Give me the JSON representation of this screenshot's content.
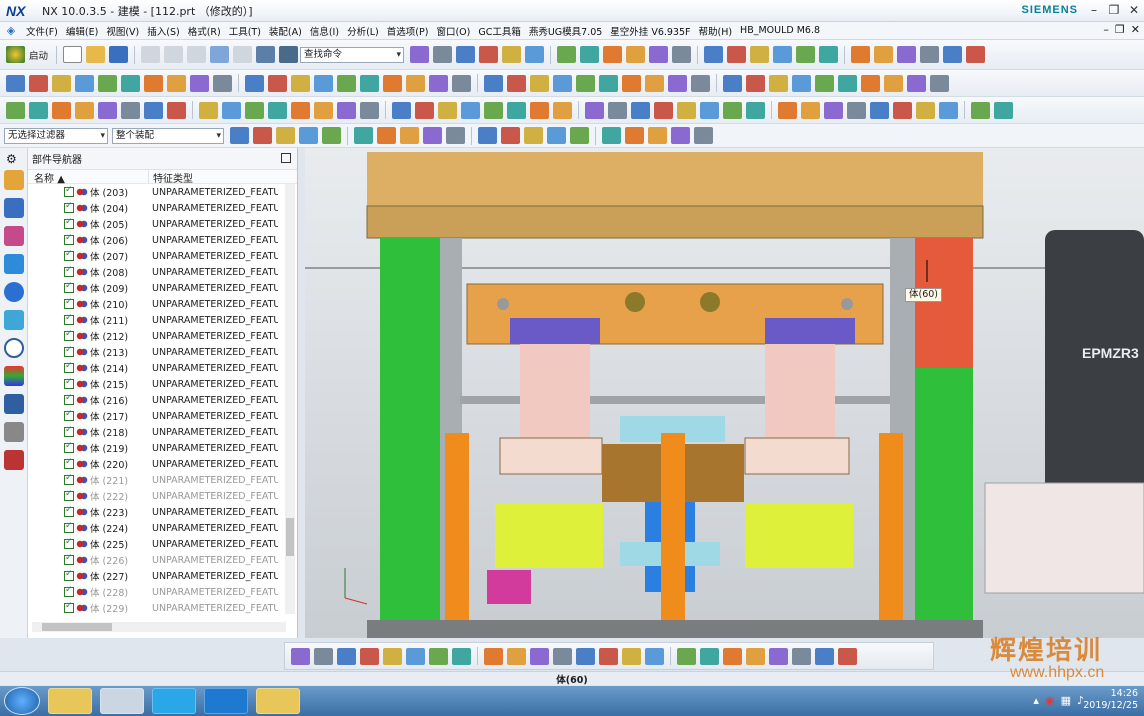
{
  "window": {
    "logo": "NX",
    "title": "NX 10.0.3.5 - 建模 - [112.prt （修改的）]",
    "brand": "SIEMENS"
  },
  "menu": [
    "文件(F)",
    "编辑(E)",
    "视图(V)",
    "插入(S)",
    "格式(R)",
    "工具(T)",
    "装配(A)",
    "信息(I)",
    "分析(L)",
    "首选项(P)",
    "窗口(O)",
    "GC工具箱",
    "燕秀UG模具7.05",
    "星空外挂 V6.935F",
    "帮助(H)",
    "HB_MOULD M6.8"
  ],
  "toolbar": {
    "start_label": "启动",
    "search_placeholder": "查找命令",
    "selection_filter": "无选择过滤器",
    "assembly_scope": "整个装配"
  },
  "navigator": {
    "title": "部件导航器",
    "col_name": "名称",
    "col_type": "特征类型",
    "rows": [
      {
        "name": "体 (203)",
        "type": "UNPARAMETERIZED_FEATU",
        "dim": false
      },
      {
        "name": "体 (204)",
        "type": "UNPARAMETERIZED_FEATU",
        "dim": false
      },
      {
        "name": "体 (205)",
        "type": "UNPARAMETERIZED_FEATU",
        "dim": false
      },
      {
        "name": "体 (206)",
        "type": "UNPARAMETERIZED_FEATU",
        "dim": false
      },
      {
        "name": "体 (207)",
        "type": "UNPARAMETERIZED_FEATU",
        "dim": false
      },
      {
        "name": "体 (208)",
        "type": "UNPARAMETERIZED_FEATU",
        "dim": false
      },
      {
        "name": "体 (209)",
        "type": "UNPARAMETERIZED_FEATU",
        "dim": false
      },
      {
        "name": "体 (210)",
        "type": "UNPARAMETERIZED_FEATU",
        "dim": false
      },
      {
        "name": "体 (211)",
        "type": "UNPARAMETERIZED_FEATU",
        "dim": false
      },
      {
        "name": "体 (212)",
        "type": "UNPARAMETERIZED_FEATU",
        "dim": false
      },
      {
        "name": "体 (213)",
        "type": "UNPARAMETERIZED_FEATU",
        "dim": false
      },
      {
        "name": "体 (214)",
        "type": "UNPARAMETERIZED_FEATU",
        "dim": false
      },
      {
        "name": "体 (215)",
        "type": "UNPARAMETERIZED_FEATU",
        "dim": false
      },
      {
        "name": "体 (216)",
        "type": "UNPARAMETERIZED_FEATU",
        "dim": false
      },
      {
        "name": "体 (217)",
        "type": "UNPARAMETERIZED_FEATU",
        "dim": false
      },
      {
        "name": "体 (218)",
        "type": "UNPARAMETERIZED_FEATU",
        "dim": false
      },
      {
        "name": "体 (219)",
        "type": "UNPARAMETERIZED_FEATU",
        "dim": false
      },
      {
        "name": "体 (220)",
        "type": "UNPARAMETERIZED_FEATU",
        "dim": false
      },
      {
        "name": "体 (221)",
        "type": "UNPARAMETERIZED_FEATU",
        "dim": true
      },
      {
        "name": "体 (222)",
        "type": "UNPARAMETERIZED_FEATU",
        "dim": true
      },
      {
        "name": "体 (223)",
        "type": "UNPARAMETERIZED_FEATU",
        "dim": false
      },
      {
        "name": "体 (224)",
        "type": "UNPARAMETERIZED_FEATU",
        "dim": false
      },
      {
        "name": "体 (225)",
        "type": "UNPARAMETERIZED_FEATU",
        "dim": false
      },
      {
        "name": "体 (226)",
        "type": "UNPARAMETERIZED_FEATU",
        "dim": true
      },
      {
        "name": "体 (227)",
        "type": "UNPARAMETERIZED_FEATU",
        "dim": false
      },
      {
        "name": "体 (228)",
        "type": "UNPARAMETERIZED_FEATU",
        "dim": true
      },
      {
        "name": "体 (229)",
        "type": "UNPARAMETERIZED_FEATU",
        "dim": true
      }
    ]
  },
  "viewport": {
    "tooltip": "体(60)",
    "label_text": "EPMZR3"
  },
  "status": {
    "selected": "体(60)"
  },
  "watermark": {
    "text": "辉煌培训",
    "url": "www.hhpx.cn"
  },
  "taskbar": {
    "time": "14:26",
    "date": "2019/12/25"
  }
}
